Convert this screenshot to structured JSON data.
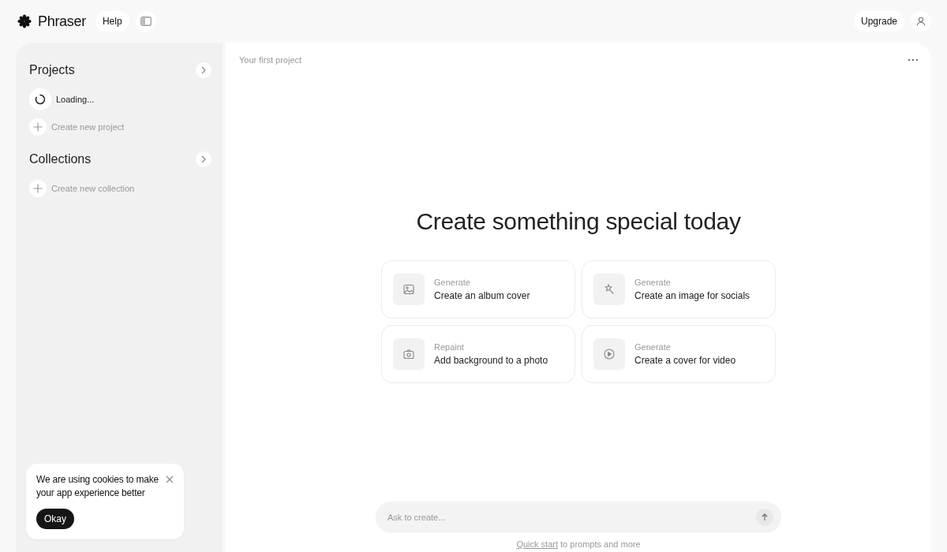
{
  "topbar": {
    "app_name": "Phraser",
    "help": "Help",
    "upgrade": "Upgrade"
  },
  "sidebar": {
    "sections": [
      {
        "title": "Projects",
        "items": [
          {
            "kind": "loading",
            "label": "Loading..."
          },
          {
            "kind": "create",
            "label": "Create new project"
          }
        ]
      },
      {
        "title": "Collections",
        "items": [
          {
            "kind": "create",
            "label": "Create new collection"
          }
        ]
      }
    ]
  },
  "main": {
    "breadcrumb": "Your first project",
    "heading": "Create something special today",
    "cards": [
      {
        "action": "Generate",
        "title": "Create an album cover"
      },
      {
        "action": "Generate",
        "title": "Create an image for socials"
      },
      {
        "action": "Repaint",
        "title": "Add background to a photo"
      },
      {
        "action": "Generate",
        "title": "Create a cover for video"
      }
    ],
    "prompt": {
      "placeholder": "Ask to create..."
    },
    "hint": {
      "link": "Quick start",
      "text": "to prompts and more"
    }
  },
  "cookie_banner": {
    "message": "We are using cookies to make your app experience better",
    "button": "Okay"
  }
}
